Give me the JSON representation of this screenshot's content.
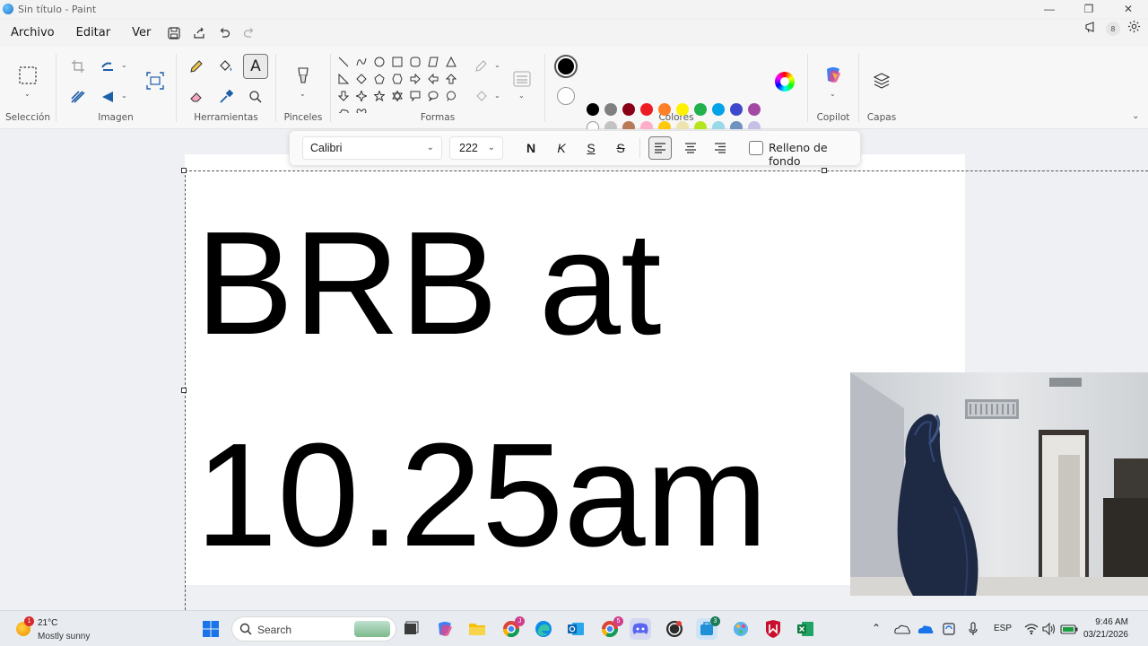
{
  "window": {
    "title": "Sin título - Paint",
    "controls": [
      "—",
      "❐",
      "✕"
    ]
  },
  "menu": {
    "items": [
      "Archivo",
      "Editar",
      "Ver"
    ],
    "notification_count": "8"
  },
  "ribbon": {
    "groups": {
      "selection": "Selección",
      "image": "Imagen",
      "tools": "Herramientas",
      "brushes": "Pinceles",
      "shapes": "Formas",
      "colors": "Colores",
      "copilot": "Copilot",
      "layers": "Capas"
    },
    "palette_row1": [
      "#000000",
      "#7f7f7f",
      "#880015",
      "#ed1c24",
      "#ff7f27",
      "#fff200",
      "#22b14c",
      "#00a2e8",
      "#3f48cc",
      "#a349a4"
    ],
    "palette_row2": [
      "#ffffff",
      "#c3c3c3",
      "#b97a57",
      "#ffaec9",
      "#ffc90e",
      "#efe4b0",
      "#b5e61d",
      "#99d9ea",
      "#7092be",
      "#c8bfe7"
    ],
    "primary_color": "#000000",
    "secondary_color": "#ffffff"
  },
  "text_toolbar": {
    "font": "Calibri",
    "size": "222",
    "bold": "N",
    "italic": "K",
    "underline": "S",
    "strikethrough": "S",
    "fill_label": "Relleno de fondo"
  },
  "canvas": {
    "line1": "BRB at",
    "line2": "10.25am"
  },
  "taskbar": {
    "weather_temp": "21°C",
    "weather_condition": "Mostly sunny",
    "weather_badge": "1",
    "search_placeholder": "Search",
    "language": "ESP",
    "time": "9:46 AM",
    "date": "03/21/2026",
    "badges": {
      "chrome1": "J",
      "chrome2": "5",
      "app3": "3"
    }
  }
}
